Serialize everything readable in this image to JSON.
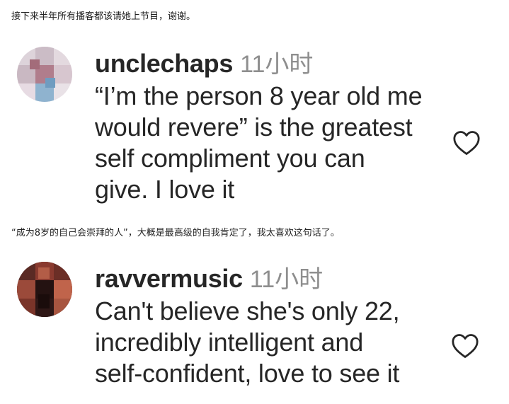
{
  "captions": {
    "top": "接下来半年所有播客都该请她上节目，谢谢。",
    "middle": "“成为8岁的自己会崇拜的人”，大概是最高级的自我肯定了，我太喜欢这句话了。"
  },
  "comments": [
    {
      "username": "unclechaps",
      "timestamp": "11小时",
      "text_lines": [
        "“I’m the person 8 year old me",
        "would revere” is the greatest",
        "self compliment you can",
        "give. I love it"
      ],
      "like_icon": "heart-outline-icon",
      "avatar_colors": [
        "#c9b8c2",
        "#e7dbe3",
        "#b07d8c",
        "#8fb3cf"
      ]
    },
    {
      "username": "ravvermusic",
      "timestamp": "11小时",
      "text_lines": [
        "Can't believe she's only 22,",
        "incredibly intelligent and",
        "self-confident, love to see it"
      ],
      "like_icon": "heart-outline-icon",
      "avatar_colors": [
        "#3a1d1c",
        "#8a3a2f",
        "#c0644b",
        "#241211"
      ]
    }
  ],
  "colors": {
    "username": "#262626",
    "timestamp": "#8e8e8e",
    "text": "#262626",
    "icon": "#262626"
  }
}
